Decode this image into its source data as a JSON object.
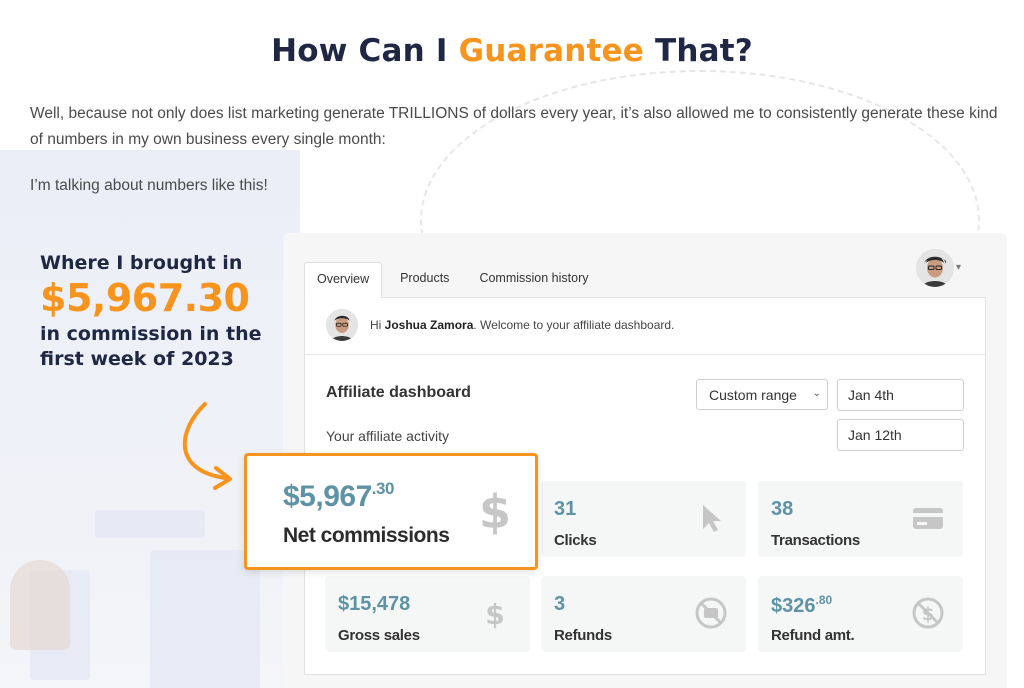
{
  "headline": {
    "part1": "How Can I ",
    "accent": "Guarantee",
    "part2": " That?"
  },
  "paragraph1": "Well, because not only does list marketing generate TRILLIONS of dollars every year, it’s also allowed me to consistently generate these kind of numbers in my own business every single month:",
  "paragraph2": "I’m talking about numbers like this!",
  "promo": {
    "lead": "Where I brought in",
    "amount": "$5,967.30",
    "tail": "in commission in the first week of 2023"
  },
  "dashboard": {
    "tabs": [
      "Overview",
      "Products",
      "Commission history"
    ],
    "welcome_prefix": "Hi ",
    "user_name": "Joshua Zamora",
    "welcome_suffix": ". Welcome to your affiliate dashboard.",
    "title": "Affiliate dashboard",
    "subtitle": "Your affiliate activity",
    "range_select": "Custom range",
    "date_from": "Jan 4th",
    "date_to": "Jan 12th",
    "highlight": {
      "value": "$5,967",
      "cents": ".30",
      "label": "Net commissions",
      "icon": "dollar-icon"
    },
    "stats": [
      {
        "value": "31",
        "cents": "",
        "label": "Clicks",
        "icon": "cursor-icon"
      },
      {
        "value": "38",
        "cents": "",
        "label": "Transactions",
        "icon": "credit-card-icon"
      },
      {
        "value": "$15,478",
        "cents": "",
        "label": "Gross sales",
        "icon": "dollar-icon"
      },
      {
        "value": "3",
        "cents": "",
        "label": "Refunds",
        "icon": "refund-icon"
      },
      {
        "value": "$326",
        "cents": ".80",
        "label": "Refund amt.",
        "icon": "no-dollar-icon"
      }
    ]
  },
  "colors": {
    "accent": "#f7941d",
    "navy": "#1f2744",
    "stat_value": "#5e93a6"
  }
}
